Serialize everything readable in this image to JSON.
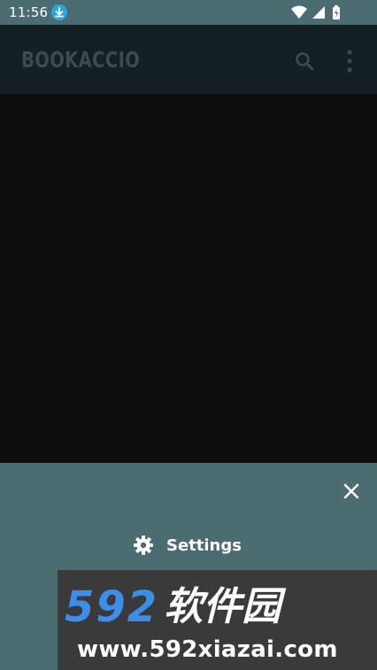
{
  "status_bar": {
    "time": "11:56",
    "icons": [
      "download-icon",
      "wifi-icon",
      "signal-icon",
      "battery-icon"
    ]
  },
  "app_bar": {
    "title": "BOOKACCIO",
    "actions": [
      "search-icon",
      "more-vert-icon"
    ]
  },
  "bottom_sheet": {
    "settings_label": "Settings",
    "icons": [
      "close-icon",
      "gear-icon"
    ]
  },
  "watermark": {
    "digits": "592",
    "chars": "软件园",
    "url": "www.592xiazai.com"
  },
  "colors": {
    "status_bar_bg": "#4b6c71",
    "app_bar_bg": "#142024",
    "content_bg": "#0f0f0f",
    "sheet_bg": "#4b6c71",
    "title_text": "#3f4a4c",
    "download_badge": "#29a8e0",
    "watermark_bg": "#3a3a3a",
    "watermark_digits": "#3c8ee8"
  }
}
